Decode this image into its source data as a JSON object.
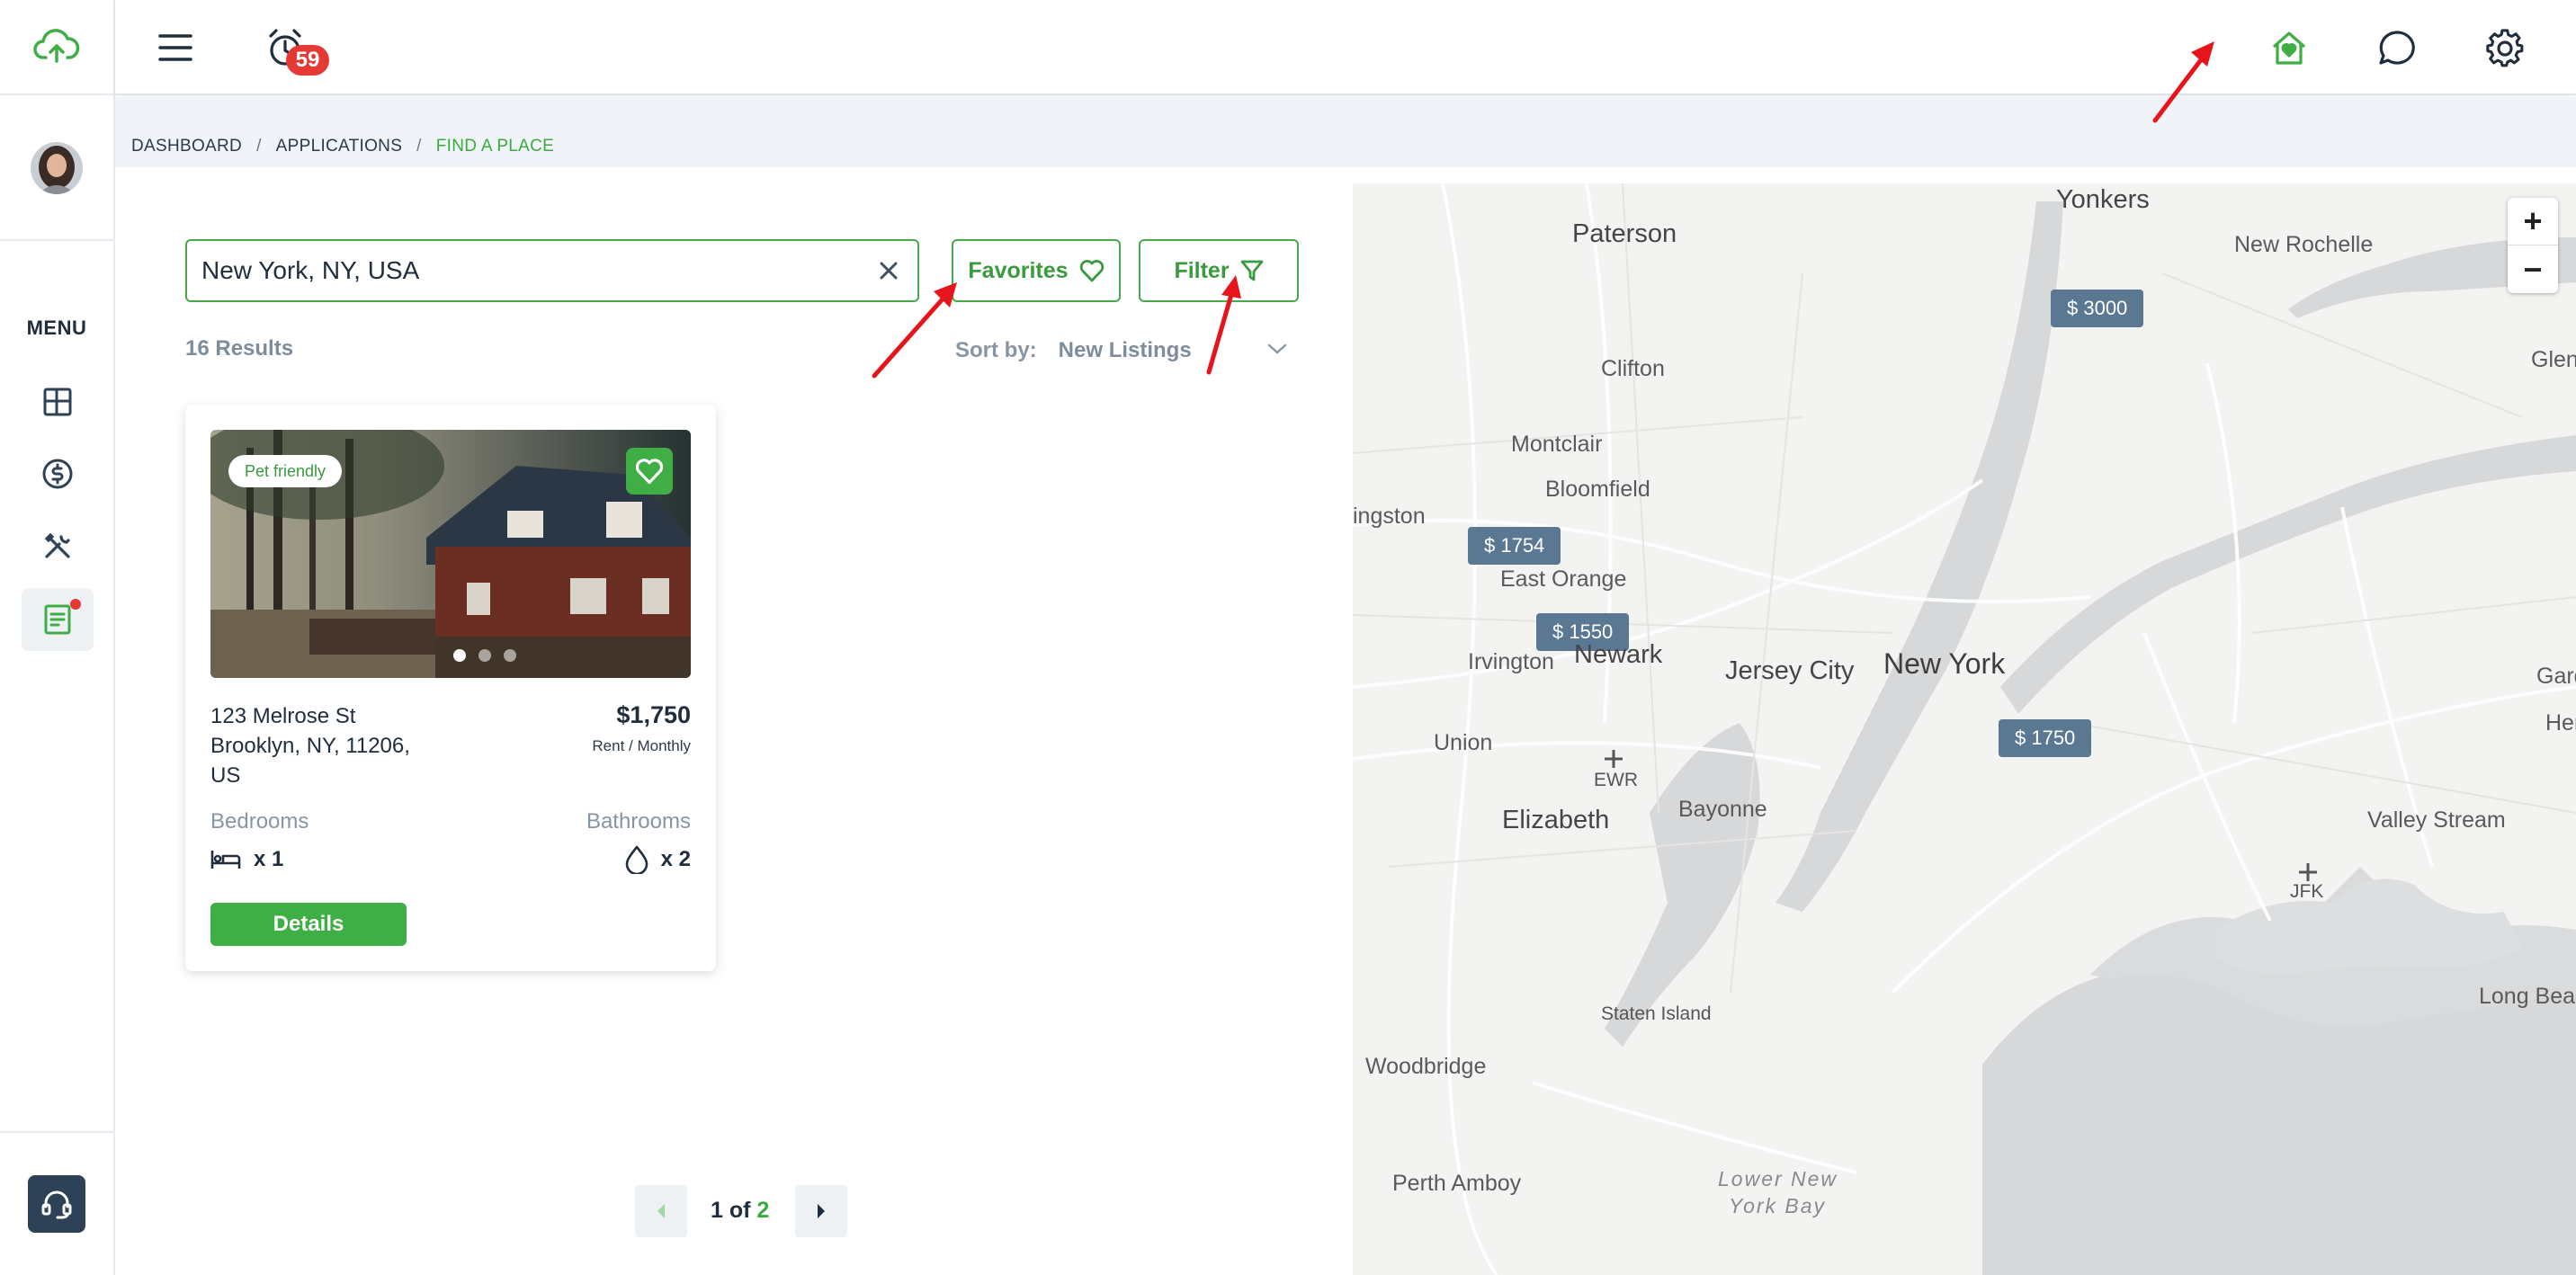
{
  "header": {
    "notification_count": "59"
  },
  "sidebar": {
    "menu_label": "MENU"
  },
  "breadcrumb": {
    "items": [
      "DASHBOARD",
      "APPLICATIONS",
      "FIND A PLACE"
    ],
    "separator": "/"
  },
  "search": {
    "value": "New York, NY, USA",
    "placeholder": ""
  },
  "toolbar": {
    "favorites_label": "Favorites",
    "filter_label": "Filter"
  },
  "results": {
    "count_text": "16 Results",
    "sort_label": "Sort by:",
    "sort_value": "New Listings"
  },
  "listing": {
    "tag": "Pet friendly",
    "address_line1": "123 Melrose St",
    "address_line2": "Brooklyn, NY, 11206,",
    "address_line3": "US",
    "price": "$1,750",
    "price_period": "Rent / Monthly",
    "bedrooms_label": "Bedrooms",
    "bedrooms_value": "x 1",
    "bathrooms_label": "Bathrooms",
    "bathrooms_value": "x 2",
    "details_label": "Details"
  },
  "pagination": {
    "current_text": "1 of",
    "total": "2"
  },
  "map": {
    "zoom_in": "+",
    "zoom_out": "−",
    "markers": [
      "$ 3000",
      "$ 1754",
      "$ 1550",
      "$ 1750"
    ],
    "places": [
      "Yonkers",
      "Paterson",
      "New Rochelle",
      "Clifton",
      "Glen",
      "Montclair",
      "Bloomfield",
      "ingston",
      "East Orange",
      "Irvington",
      "Newark",
      "Jersey City",
      "New York",
      "Garde",
      "Hen",
      "Union",
      "EWR",
      "Elizabeth",
      "Bayonne",
      "Valley Stream",
      "JFK",
      "Staten Island",
      "Woodbridge",
      "Long Beac",
      "Perth Amboy",
      "Lower New",
      "York Bay"
    ]
  },
  "colors": {
    "brand_green": "#3fae44",
    "marker": "#5b7893",
    "badge_red": "#e53935",
    "annotation_red": "#e8141b"
  }
}
